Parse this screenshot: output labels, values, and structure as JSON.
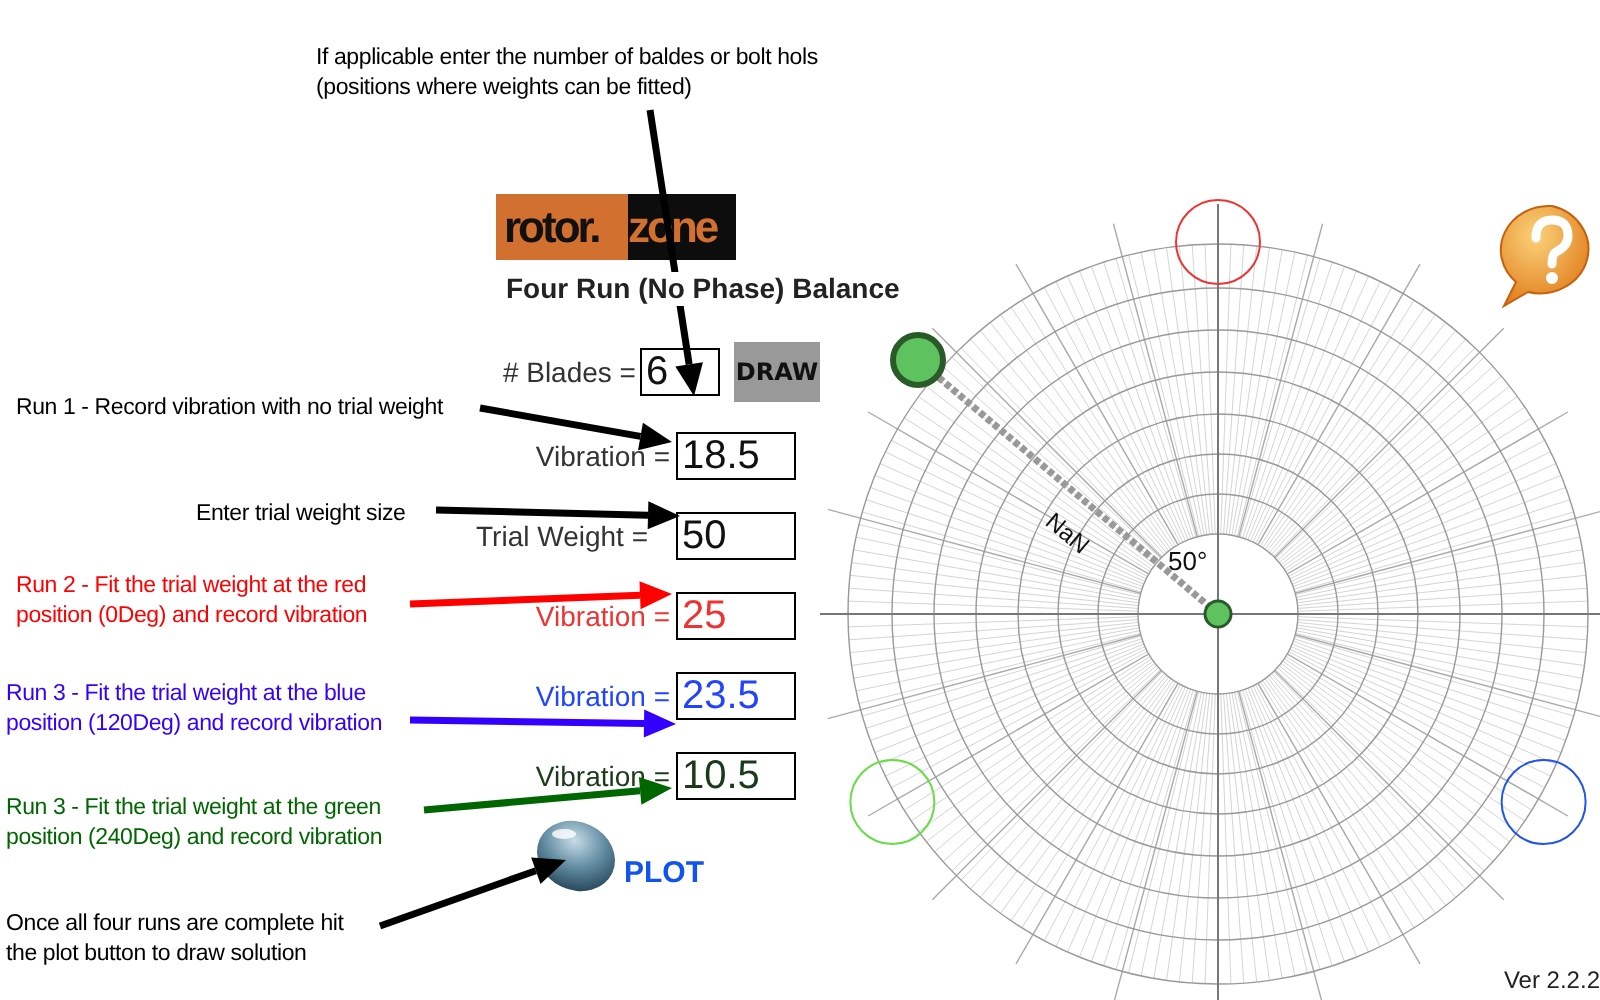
{
  "annotations": [
    {
      "text": "If applicable enter the number of baldes or bolt hols\n(positions where weights can be fitted)",
      "color": "#000000"
    },
    {
      "text": "Run 1 - Record vibration with no trial weight",
      "color": "#000000"
    },
    {
      "text": "Enter trial weight size",
      "color": "#000000"
    },
    {
      "text": "Run 2 - Fit the trial weight at the red\nposition (0Deg) and record vibration",
      "color": "#ff0000"
    },
    {
      "text": "Run 3 - Fit the trial weight at the blue\nposition (120Deg) and record vibration",
      "color": "#3300ff"
    },
    {
      "text": "Run 3 - Fit the trial weight at the green\nposition (240Deg) and record vibration",
      "color": "#006600"
    },
    {
      "text": "Once all four runs are complete hit\nthe plot button to draw solution",
      "color": "#000000"
    }
  ],
  "logo": {
    "part_1": "rotor.",
    "part_2": "zone"
  },
  "title": "Four Run (No Phase) Balance",
  "blades": {
    "label": "# Blades =",
    "value": "6"
  },
  "draw_button": "DRAW",
  "fields": [
    {
      "label": "Vibration =",
      "value": "18.5",
      "color": "#111111"
    },
    {
      "label": "Trial Weight =",
      "value": "50",
      "color": "#111111"
    },
    {
      "label": "Vibration =",
      "value": "25",
      "color": "#ee3333"
    },
    {
      "label": "Vibration =",
      "value": "23.5",
      "color": "#2244ff"
    },
    {
      "label": "Vibration =",
      "value": "10.5",
      "color": "#1a3a1a"
    }
  ],
  "plot_button": "PLOT",
  "chart": {
    "vector_length": "NaN",
    "vector_angle": "50°",
    "trial_positions": [
      {
        "color": "#ee3333"
      },
      {
        "color": "#2255ee"
      },
      {
        "color": "#66dd44"
      }
    ]
  },
  "version": "Ver 2.2.2"
}
